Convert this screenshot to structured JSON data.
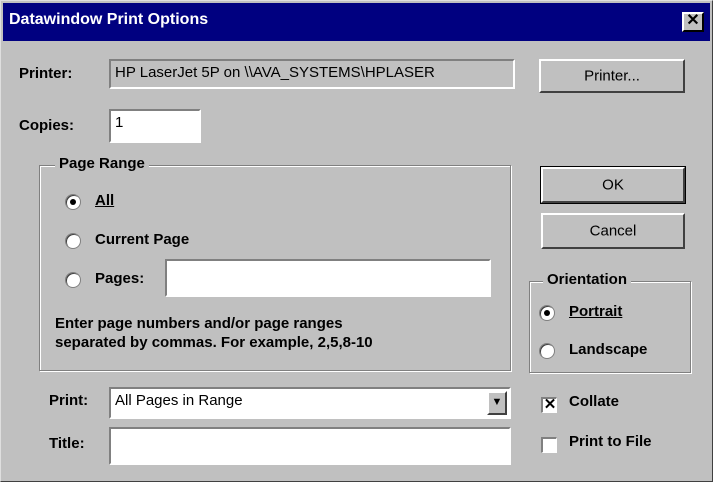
{
  "window": {
    "title": "Datawindow Print Options"
  },
  "printer": {
    "label": "Printer:",
    "value": "HP LaserJet 5P on \\\\AVA_SYSTEMS\\HPLASER",
    "button": "Printer..."
  },
  "copies": {
    "label": "Copies:",
    "value": "1"
  },
  "page_range": {
    "title": "Page Range",
    "all": "All",
    "current_page": "Current Page",
    "pages": "Pages:",
    "pages_value": "",
    "hint_line1": "Enter page numbers and/or page ranges",
    "hint_line2": "separated by commas. For example, 2,5,8-10",
    "selected": "All"
  },
  "buttons": {
    "ok": "OK",
    "cancel": "Cancel"
  },
  "orientation": {
    "title": "Orientation",
    "portrait": "Portrait",
    "landscape": "Landscape",
    "selected": "Portrait"
  },
  "print": {
    "label": "Print:",
    "value": "All Pages in Range"
  },
  "title_field": {
    "label": "Title:",
    "value": ""
  },
  "collate": {
    "label": "Collate",
    "checked": true
  },
  "print_to_file": {
    "label": "Print to File",
    "checked": false
  },
  "icons": {
    "close": "close-icon",
    "dropdown": "chevron-down-icon"
  }
}
